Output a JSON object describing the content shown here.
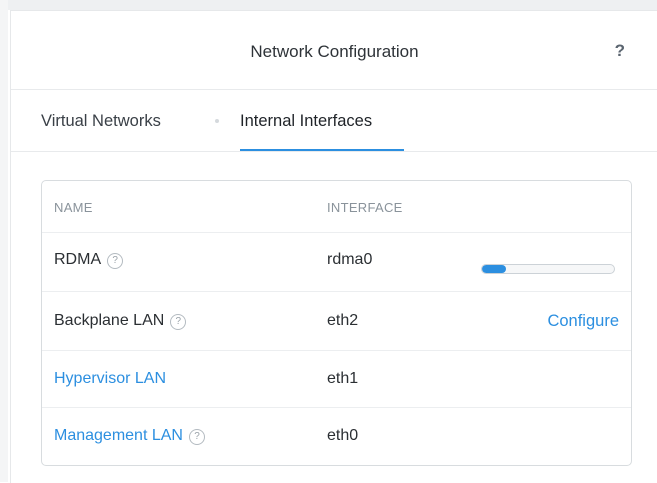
{
  "header": {
    "title": "Network Configuration",
    "help_icon_text": "?"
  },
  "tabs": [
    {
      "label": "Virtual Networks",
      "active": false
    },
    {
      "label": "Internal Interfaces",
      "active": true
    }
  ],
  "table": {
    "columns": [
      "NAME",
      "INTERFACE"
    ],
    "rows": [
      {
        "name": "RDMA",
        "interface": "rdma0",
        "help": "?",
        "link": false,
        "progress": 0.18
      },
      {
        "name": "Backplane LAN",
        "interface": "eth2",
        "help": "?",
        "link": false,
        "action": "Configure"
      },
      {
        "name": "Hypervisor LAN",
        "interface": "eth1",
        "link": true
      },
      {
        "name": "Management LAN",
        "interface": "eth0",
        "help": "?",
        "link": true
      }
    ]
  },
  "icons": {
    "help": "question-mark-icon",
    "info": "question-circle-icon"
  },
  "colors": {
    "accent": "#2c8fe0",
    "border": "#d8dcdf",
    "muted": "#8a939b"
  }
}
